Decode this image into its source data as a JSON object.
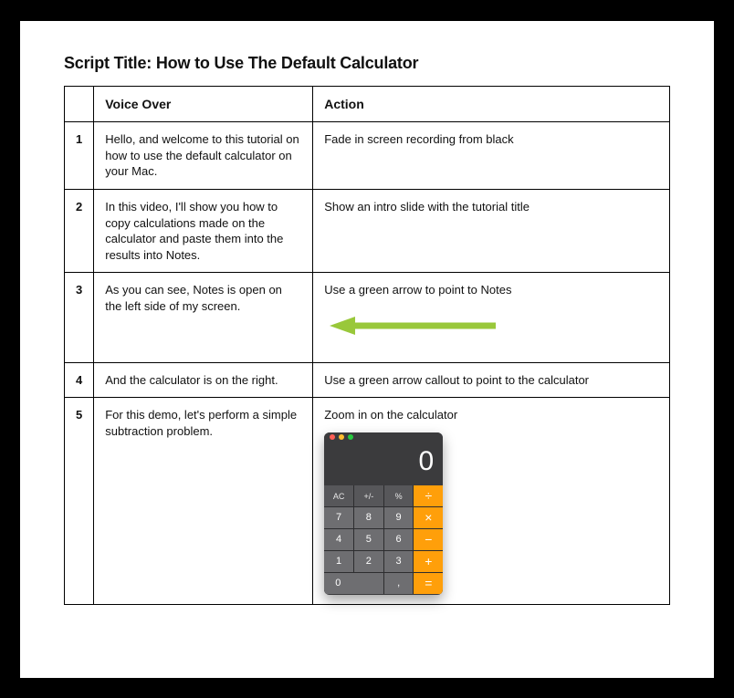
{
  "title": "Script Title: How to Use The Default Calculator",
  "headers": {
    "num": "",
    "voice_over": "Voice Over",
    "action": "Action"
  },
  "rows": [
    {
      "num": "1",
      "voice_over": "Hello, and welcome to this tutorial on how to use the default calculator on your Mac.",
      "action": "Fade in screen recording from black"
    },
    {
      "num": "2",
      "voice_over": "In this video, I'll show you how to copy calculations made on the calculator and paste them into the results into Notes.",
      "action": "Show an intro slide with the tutorial title"
    },
    {
      "num": "3",
      "voice_over": "As you can see, Notes is open on the left side of my screen.",
      "action": "Use a green arrow to point to Notes"
    },
    {
      "num": "4",
      "voice_over": "And the calculator is on the right.",
      "action": "Use a green arrow callout to point to the calculator"
    },
    {
      "num": "5",
      "voice_over": "For this demo, let's perform a simple subtraction problem.",
      "action": "Zoom in on the calculator"
    }
  ],
  "arrow_color": "#99c83a",
  "calculator": {
    "display": "0",
    "buttons": {
      "ac": "AC",
      "sign": "+/-",
      "pct": "%",
      "div": "÷",
      "b7": "7",
      "b8": "8",
      "b9": "9",
      "mul": "×",
      "b4": "4",
      "b5": "5",
      "b6": "6",
      "sub": "−",
      "b1": "1",
      "b2": "2",
      "b3": "3",
      "add": "+",
      "b0": "0",
      "dot": ",",
      "eq": "="
    }
  }
}
